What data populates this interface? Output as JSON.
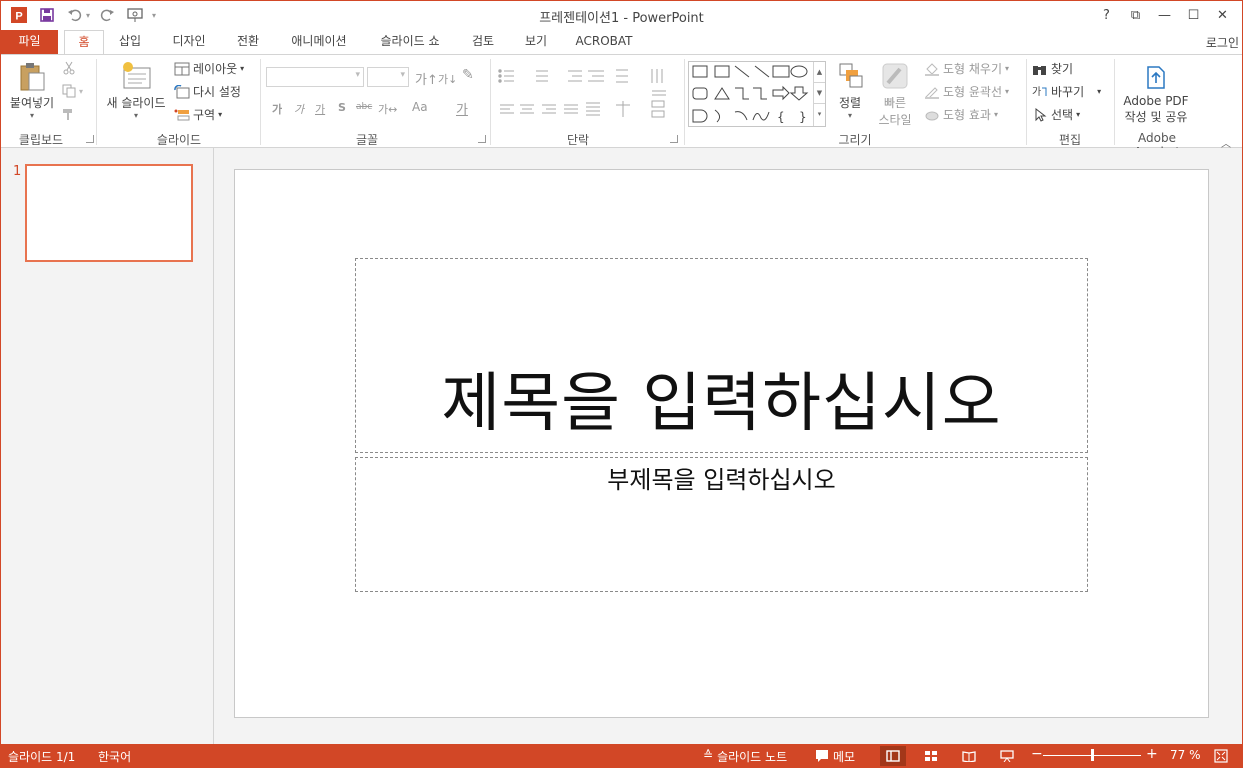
{
  "window": {
    "title": "프레젠테이션1 - PowerPoint",
    "controls": {
      "help": "?",
      "ribbon_display": "⧉",
      "minimize": "—",
      "maximize": "☐",
      "close": "✕"
    }
  },
  "tabs": [
    {
      "label": "파일"
    },
    {
      "label": "홈"
    },
    {
      "label": "삽입"
    },
    {
      "label": "디자인"
    },
    {
      "label": "전환"
    },
    {
      "label": "애니메이션"
    },
    {
      "label": "슬라이드 쇼"
    },
    {
      "label": "검토"
    },
    {
      "label": "보기"
    },
    {
      "label": "ACROBAT"
    }
  ],
  "active_tab": "홈",
  "login": "로그인",
  "ribbon": {
    "clipboard": {
      "label": "클립보드",
      "paste": "붙여넣기"
    },
    "slides": {
      "label": "슬라이드",
      "new_slide": "새 슬라이드",
      "layout": "레이아웃",
      "reset": "다시 설정",
      "section": "구역"
    },
    "font": {
      "label": "글꼴",
      "bold": "가",
      "italic": "가",
      "underline": "가",
      "shadow": "S",
      "strike": "abc",
      "spacing": "가↔",
      "case": "Aa",
      "color": "가"
    },
    "paragraph": {
      "label": "단락"
    },
    "drawing": {
      "label": "그리기",
      "arrange": "정렬",
      "quick_styles_1": "빠른",
      "quick_styles_2": "스타일",
      "fill": "도형 채우기",
      "outline": "도형 윤곽선",
      "effects": "도형 효과"
    },
    "editing": {
      "label": "편집",
      "find": "찾기",
      "replace": "바꾸기",
      "select": "선택"
    },
    "acrobat": {
      "label": "Adobe Acrobat",
      "btn_1": "Adobe PDF",
      "btn_2": "작성 및 공유"
    }
  },
  "thumbnail": {
    "number": "1"
  },
  "slide": {
    "title_placeholder": "제목을 입력하십시오",
    "subtitle_placeholder": "부제목을 입력하십시오"
  },
  "status": {
    "slide_counter": "슬라이드 1/1",
    "language": "한국어",
    "notes": "슬라이드 노트",
    "comments": "메모",
    "zoom_out": "−",
    "zoom_in": "+",
    "zoom": "77 %",
    "zoom_level": 0.5
  },
  "colors": {
    "accent": "#d24726",
    "thumb_border": "#e8734f"
  }
}
